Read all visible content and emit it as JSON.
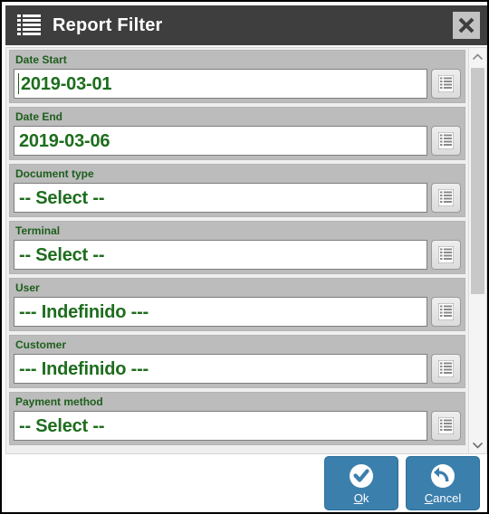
{
  "window": {
    "title": "Report Filter",
    "title_icon": "list-lines-icon",
    "close_icon": "close-icon",
    "titlebar_color": "#3e3e3e",
    "accent_color": "#3b7fad",
    "label_color": "#1d5e1d",
    "value_color": "#1d6d1d"
  },
  "fields": [
    {
      "label": "Date Start",
      "value": "2019-03-01",
      "picker_icon": "list-lines-icon",
      "has_caret": true
    },
    {
      "label": "Date End",
      "value": "2019-03-06",
      "picker_icon": "list-lines-icon",
      "has_caret": false
    },
    {
      "label": "Document type",
      "value": "-- Select --",
      "picker_icon": "list-lines-icon",
      "has_caret": false
    },
    {
      "label": "Terminal",
      "value": "-- Select --",
      "picker_icon": "list-lines-icon",
      "has_caret": false
    },
    {
      "label": "User",
      "value": "--- Indefinido ---",
      "picker_icon": "list-lines-icon",
      "has_caret": false
    },
    {
      "label": "Customer",
      "value": "--- Indefinido ---",
      "picker_icon": "list-lines-icon",
      "has_caret": false
    },
    {
      "label": "Payment method",
      "value": "-- Select --",
      "picker_icon": "list-lines-icon",
      "has_caret": false
    }
  ],
  "scrollbar": {
    "up_icon": "chevron-up-icon",
    "down_icon": "chevron-down-icon"
  },
  "footer": {
    "ok": {
      "label": "Ok",
      "accel": "O",
      "rest": "k",
      "icon": "check-circle-icon"
    },
    "cancel": {
      "label": "Cancel",
      "accel": "C",
      "rest": "ancel",
      "icon": "undo-circle-icon"
    }
  }
}
